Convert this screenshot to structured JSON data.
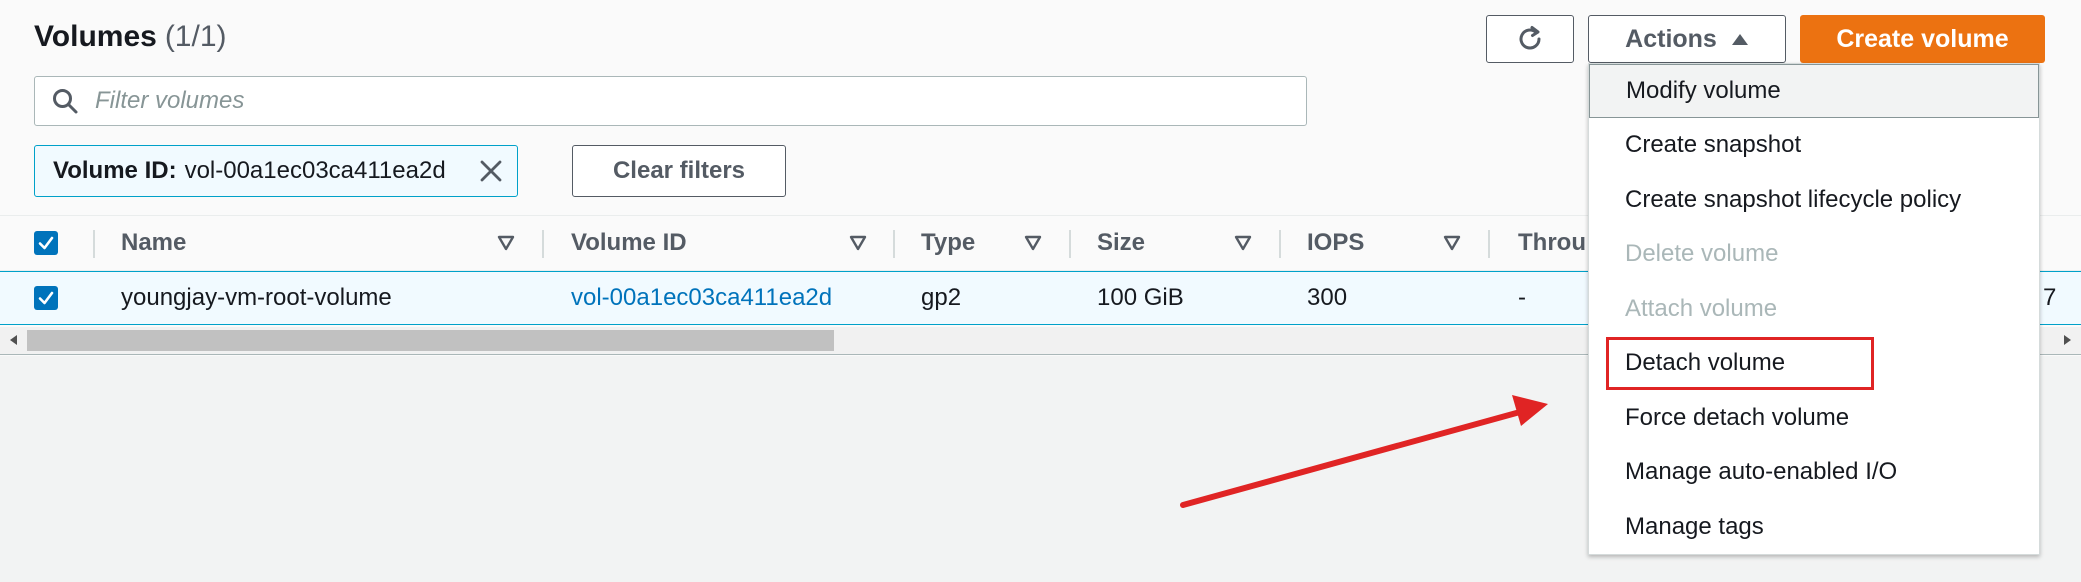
{
  "header": {
    "title": "Volumes",
    "count": "(1/1)"
  },
  "toolbar": {
    "refresh_icon": "refresh-icon",
    "actions_label": "Actions",
    "create_label": "Create volume",
    "create_color": "#ec7211"
  },
  "search": {
    "placeholder": "Filter volumes",
    "value": ""
  },
  "filter_token": {
    "key": "Volume ID:",
    "value": "vol-00a1ec03ca411ea2d"
  },
  "clear_filters_label": "Clear filters",
  "table": {
    "columns": [
      "Name",
      "Volume ID",
      "Type",
      "Size",
      "IOPS",
      "Throu"
    ],
    "rows": [
      {
        "name": "youngjay-vm-root-volume",
        "volume_id": "vol-00a1ec03ca411ea2d",
        "type": "gp2",
        "size": "100 GiB",
        "iops": "300",
        "throughput": "-",
        "overflow_tail": "7"
      }
    ]
  },
  "actions_menu": {
    "items": [
      {
        "label": "Modify volume",
        "state": "hover"
      },
      {
        "label": "Create snapshot",
        "state": "enabled"
      },
      {
        "label": "Create snapshot lifecycle policy",
        "state": "enabled"
      },
      {
        "label": "Delete volume",
        "state": "disabled"
      },
      {
        "label": "Attach volume",
        "state": "disabled"
      },
      {
        "label": "Detach volume",
        "state": "highlighted"
      },
      {
        "label": "Force detach volume",
        "state": "enabled"
      },
      {
        "label": "Manage auto-enabled I/O",
        "state": "enabled"
      },
      {
        "label": "Manage tags",
        "state": "enabled"
      }
    ]
  },
  "annotation": {
    "highlight_color": "#e02424",
    "arrow_color": "#e02424"
  }
}
